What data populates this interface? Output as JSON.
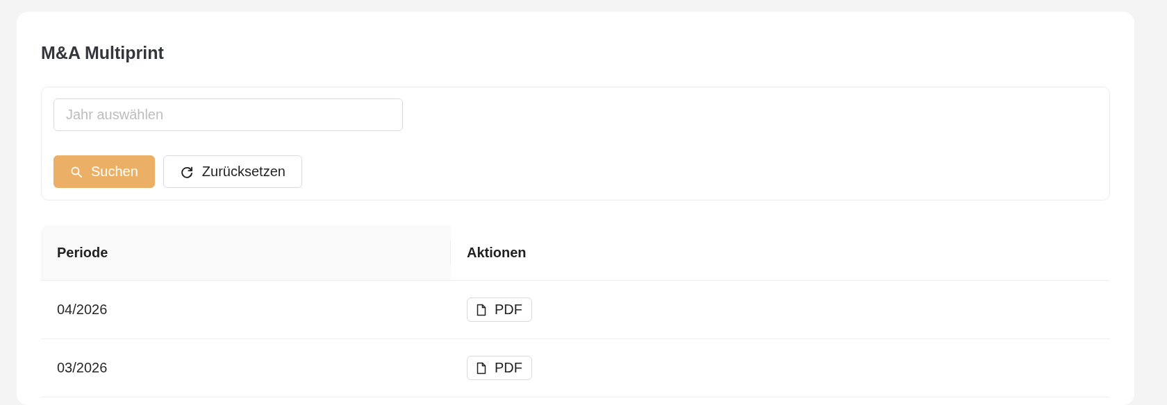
{
  "page": {
    "title": "M&A Multiprint"
  },
  "filter": {
    "year_field": {
      "placeholder": "Jahr auswählen"
    },
    "buttons": [
      {
        "label": "Suchen",
        "kind": "primary"
      },
      {
        "label": "Zurücksetzen",
        "kind": "reset"
      }
    ]
  },
  "table": {
    "columns": [
      "Periode",
      "Aktionen"
    ],
    "rows": [
      {
        "period": "04/2026",
        "action": "PDF"
      },
      {
        "period": "03/2026",
        "action": "PDF"
      }
    ]
  }
}
